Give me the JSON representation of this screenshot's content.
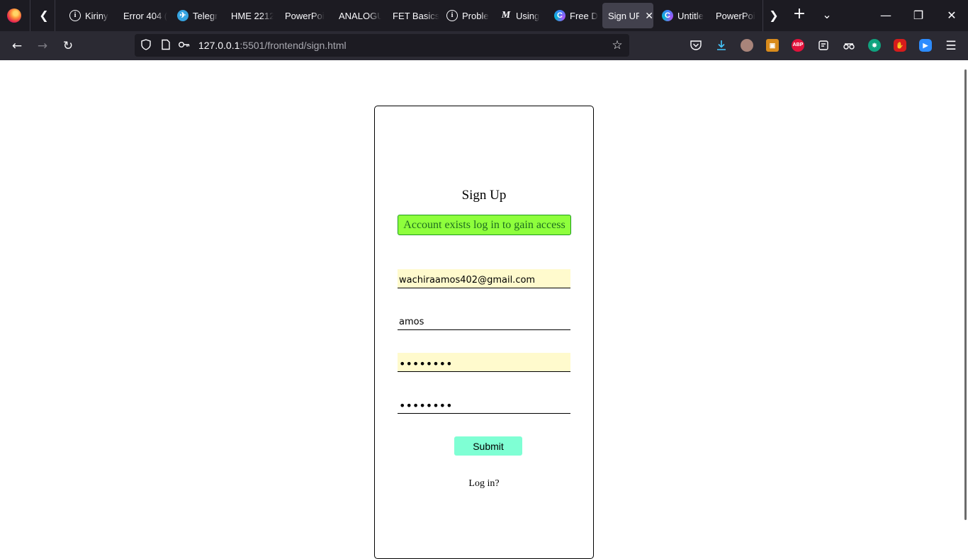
{
  "browser": {
    "tabs": [
      {
        "title": "Kiriny",
        "icon": "info-icon",
        "favicon": "i"
      },
      {
        "title": "Error 404 (",
        "icon": "none",
        "favicon": ""
      },
      {
        "title": "Telegr",
        "icon": "telegram-icon",
        "favicon": "✈"
      },
      {
        "title": "HME 2212",
        "icon": "none",
        "favicon": ""
      },
      {
        "title": "PowerPoi",
        "icon": "none",
        "favicon": ""
      },
      {
        "title": "ANALOGU",
        "icon": "none",
        "favicon": ""
      },
      {
        "title": "FET Basics",
        "icon": "none",
        "favicon": ""
      },
      {
        "title": "Proble",
        "icon": "info-icon",
        "favicon": "i"
      },
      {
        "title": "Using",
        "icon": "medium-icon",
        "favicon": "M"
      },
      {
        "title": "Free D",
        "icon": "canva-icon",
        "favicon": "C"
      },
      {
        "title": "Sign UP",
        "icon": "none",
        "favicon": "",
        "active": true
      },
      {
        "title": "Untitle",
        "icon": "canva-icon",
        "favicon": "C"
      },
      {
        "title": "PowerPoi",
        "icon": "none",
        "favicon": ""
      }
    ],
    "tab_close_glyph": "✕",
    "url_host": "127.0.0.1",
    "url_path": ":5501/frontend/sign.html",
    "extensions": [
      {
        "name": "pocket-icon",
        "label": "",
        "color": "#2b2a33"
      },
      {
        "name": "downloads-icon",
        "label": "",
        "color": "#2b2a33"
      },
      {
        "name": "profile-avatar-icon",
        "label": "",
        "color": "#a8847a"
      },
      {
        "name": "slides-extension-icon",
        "label": "",
        "color": "#d98b1c"
      },
      {
        "name": "adblock-plus-icon",
        "label": "ABP",
        "color": "#e2123b"
      },
      {
        "name": "reader-extension-icon",
        "label": "",
        "color": "#3a3944"
      },
      {
        "name": "spy-extension-icon",
        "label": "",
        "color": "#3a3944"
      },
      {
        "name": "chatgpt-extension-icon",
        "label": "",
        "color": "#10a37f"
      },
      {
        "name": "stop-hand-extension-icon",
        "label": "",
        "color": "#d61c1c"
      },
      {
        "name": "zoom-extension-icon",
        "label": "",
        "color": "#2d8cff"
      }
    ]
  },
  "page": {
    "title": "Sign Up",
    "alert": "Account exists log in to gain access",
    "email_value": "wachiraamos402@gmail.com",
    "username_value": "amos",
    "password_value": "••••••••",
    "confirm_password_value": "••••••••",
    "submit_label": "Submit",
    "login_link": "Log in?",
    "colors": {
      "alert_bg": "#8eff3c",
      "alert_border": "#1e9b1e",
      "submit_bg": "#7fffd4",
      "autofill_bg": "#fffacd"
    }
  }
}
